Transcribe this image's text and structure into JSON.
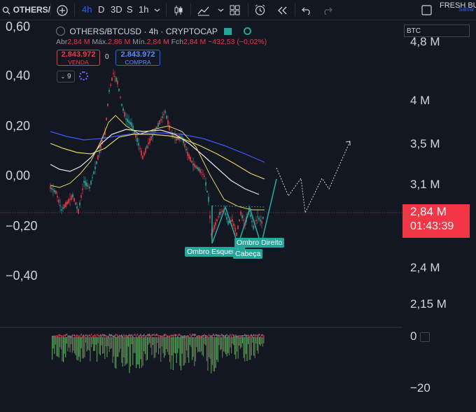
{
  "toolbar": {
    "symbol": "OTHERS/",
    "intervals": [
      "4h",
      "D",
      "3D",
      "S",
      "1h"
    ],
    "active_interval": "4h",
    "layout_name": "FRESH BU",
    "save_label": "Salvar"
  },
  "legend": {
    "title": "OTHERS/BTCUSD · 4h · CRYPTOCAP",
    "ohlc": {
      "open_label": "Abr",
      "open": "2,84 M",
      "high_label": "Máx.",
      "high": "2,86 M",
      "low_label": "Mín.",
      "low": "2,84 M",
      "close_label": "Fch",
      "close": "2,84 M",
      "change": "−432,53 (−0,02%)"
    },
    "sell_price": "2.843.972",
    "sell_label": "VENDA",
    "spread": "0",
    "buy_price": "2.843.972",
    "buy_label": "COMPRA",
    "indicator_count": "9"
  },
  "compare_input": "BTC",
  "left_axis": [
    "0,60",
    "0,40",
    "0,20",
    "0,00",
    "−0,20",
    "−0,40"
  ],
  "right_axis": [
    "4,8 M",
    "4 M",
    "3,5 M",
    "3,1 M",
    "2,4 M",
    "2,15 M"
  ],
  "last_price": {
    "value": "2,84 M",
    "countdown": "01:43:39"
  },
  "pattern_labels": {
    "left": "Ombro Esquerdo",
    "head": "Cabeça",
    "right": "Ombro Direito"
  },
  "oscillator_axis": [
    "0",
    "−20"
  ],
  "colors": {
    "background": "#131722",
    "up": "#26a69a",
    "down": "#f23645",
    "accent": "#2962ff",
    "ma_blue": "#3d5afe",
    "ma_yellow": "#e6d55a",
    "ma_white": "#e8e8e8",
    "histogram": "#4caf50"
  },
  "icons": [
    "search-icon",
    "add-symbol-icon",
    "chevron-down-icon",
    "candles-icon",
    "indicators-icon",
    "layouts-icon",
    "alert-icon",
    "replay-icon",
    "undo-icon",
    "redo-icon",
    "fullscreen-icon",
    "eye-icon",
    "settings-icon"
  ]
}
